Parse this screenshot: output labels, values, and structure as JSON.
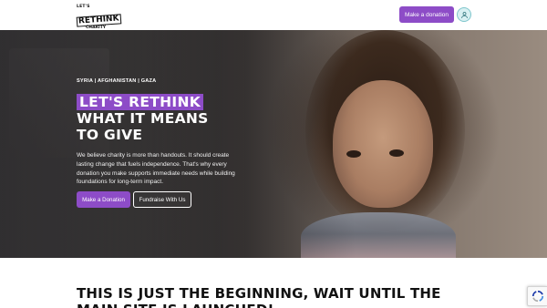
{
  "header": {
    "logo": {
      "line1": "LET'S",
      "line2": "RETHINK",
      "line3": "CHARITY"
    },
    "donate_label": "Make a donation",
    "user_icon": "user-icon"
  },
  "hero": {
    "countries": "SYRIA  |  AFGHANISTAN  |  GAZA",
    "title_highlight": "LET'S RETHINK",
    "title_line2": "WHAT IT MEANS",
    "title_line3": "TO GIVE",
    "lead": "We believe charity is more than handouts. It should create lasting change that fuels independence. That's why every donation you make supports immediate needs while building foundations for long-term impact.",
    "primary_cta": "Make a Donation",
    "secondary_cta": "Fundraise With Us"
  },
  "section": {
    "heading": "THIS IS JUST THE BEGINNING, WAIT UNTIL THE MAIN SITE IS LAUNCHED!"
  },
  "colors": {
    "accent": "#8d4cc7"
  }
}
